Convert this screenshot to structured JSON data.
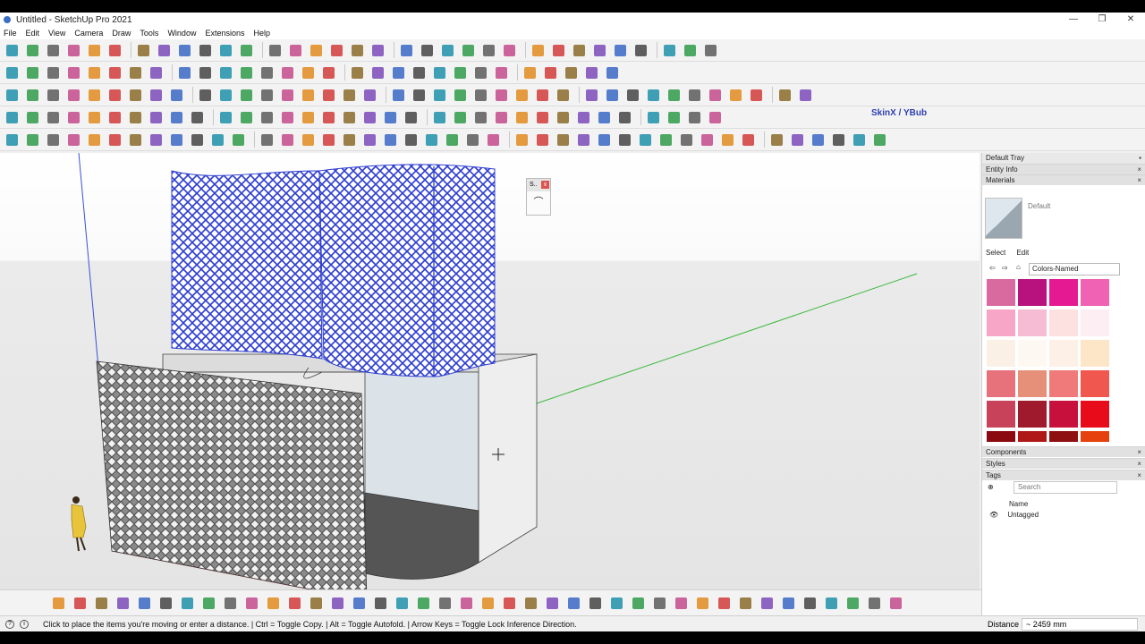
{
  "window": {
    "title": "Untitled - SketchUp Pro 2021",
    "controls": [
      "—",
      "❐",
      "✕"
    ]
  },
  "menu": [
    "File",
    "Edit",
    "View",
    "Camera",
    "Draw",
    "Tools",
    "Window",
    "Extensions",
    "Help"
  ],
  "toolbar_icons": {
    "row1": [
      "select",
      "eraser",
      "pencil",
      "line",
      "paint",
      "offset",
      "move",
      "rotate",
      "scale",
      "tape",
      "text",
      "protractor",
      "orbit",
      "pan",
      "zoom",
      "zoom-extents",
      "walk",
      "look",
      "section",
      "layout",
      "3d-warehouse",
      "extension",
      "play",
      "stop",
      "dim",
      "label",
      "axis",
      "palette",
      "arrow-red",
      "arrow-pink",
      "arrow-blue",
      "arrow-green",
      "arrow-purple"
    ],
    "row2": [
      "follow",
      "push",
      "arc",
      "circle",
      "polygon",
      "rect",
      "shape",
      "sandbox",
      "smoove",
      "stamp",
      "drape",
      "flip",
      "grid",
      "weld",
      "fillet",
      "chamfer",
      "extrude",
      "loft",
      "shell",
      "split",
      "join",
      "info",
      "settings",
      "undo",
      "redo",
      "camera",
      "circle-dark",
      "close-dark",
      "curve"
    ],
    "row3": [
      "cube",
      "box",
      "sphere",
      "cylinder",
      "cone",
      "torus",
      "pyramid",
      "wedge",
      "dome",
      "slab",
      "wall",
      "door",
      "window",
      "stair",
      "roof",
      "floor",
      "column",
      "beam",
      "truss",
      "grid",
      "truss2",
      "tube",
      "knot",
      "pipe",
      "frame",
      "joint",
      "layer",
      "solid",
      "intersect",
      "union",
      "subtract",
      "trim",
      "split",
      "shell",
      "outer",
      "mail",
      "info",
      "user"
    ],
    "row4": [
      "list",
      "tab1",
      "tab2",
      "tab3",
      "tab4",
      "tab5",
      "tab6",
      "tab7",
      "curve1",
      "curve2",
      "check",
      "cube2",
      "sq1",
      "sq2",
      "sq3",
      "sine",
      "zigzag",
      "wave",
      "spline",
      "arc2",
      "circle2",
      "helix",
      "bezier",
      "curvy",
      "hook",
      "spiral",
      "node",
      "tag",
      "skin",
      "fold",
      "clover",
      "bolt",
      "scissor",
      "brush"
    ],
    "row5": [
      "fredo1",
      "fredo2",
      "fredo3",
      "fredo4",
      "fredo5",
      "fredo6",
      "fredo7",
      "fredo8",
      "fredo9",
      "fredo10",
      "fredo11",
      "fredo12",
      "fredo13",
      "fredo14",
      "fredo15",
      "fredo16",
      "fredo17",
      "fredo18",
      "fredo19",
      "fredo20",
      "fredo21",
      "fredo22",
      "fredo23",
      "fredo24",
      "fredo25",
      "fredo26",
      "fredo27",
      "fredo28",
      "fredo29",
      "fredo30",
      "fredo31",
      "fredo32",
      "fredo33",
      "fredo34",
      "fredo35",
      "fredo36",
      "fredo37",
      "fredo38",
      "fredo39",
      "fredo40",
      "fredo41",
      "fredo42"
    ],
    "bottom": [
      "b1",
      "b2",
      "b3",
      "b4",
      "b5",
      "b6",
      "b7",
      "b8",
      "b9",
      "b10",
      "b11",
      "b12",
      "b13",
      "b14",
      "b15",
      "b16",
      "b17",
      "b18",
      "b19",
      "b20",
      "b21",
      "b22",
      "b23",
      "b24",
      "b25",
      "b26",
      "b27",
      "b28",
      "b29",
      "b30",
      "b31",
      "b32",
      "b33",
      "b34",
      "b35",
      "b36",
      "b37",
      "b38",
      "b39",
      "b40"
    ]
  },
  "skin_label": "SkinX / YBub",
  "mini_panel": {
    "title": "S..",
    "close": "x",
    "button": "⌒"
  },
  "tray": {
    "title": "Default Tray",
    "entity_info": "Entity Info",
    "materials": "Materials",
    "material_name": "Default",
    "select_tab": "Select",
    "edit_tab": "Edit",
    "library": "Colors-Named",
    "components": "Components",
    "styles": "Styles",
    "tags": "Tags",
    "search_placeholder": "Search",
    "name_header": "Name",
    "tag_name": "Untagged",
    "swatch_colors": [
      "#d86aa0",
      "#b8127e",
      "#e51992",
      "#f062b4",
      "#f7a6c8",
      "#f5bcd3",
      "#fde0e0",
      "#fceef3",
      "#faf0e6",
      "#fdf8f2",
      "#fdf0e6",
      "#fde6c8",
      "#e8727c",
      "#e6907a",
      "#f07a7a",
      "#f0574f",
      "#c8435a",
      "#9e1a2c",
      "#c8103c",
      "#e80c1a",
      "#8a0a10",
      "#b01818",
      "#8e1010",
      "#e6400e"
    ]
  },
  "status": {
    "text": "Click to place the items you're moving or enter a distance. | Ctrl = Toggle Copy. | Alt = Toggle Autofold. | Arrow Keys = Toggle Lock Inference Direction.",
    "distance_label": "Distance",
    "distance_value": "~ 2459 mm"
  }
}
